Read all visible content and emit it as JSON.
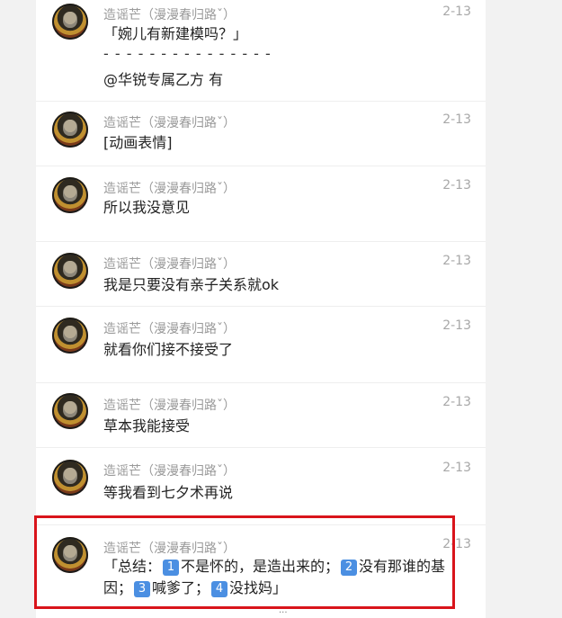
{
  "comments": [
    {
      "user": "造谣芒（漫漫春归路ˇ）",
      "date": "2-13",
      "text": "「婉儿有新建模吗？」",
      "dashes": "- - - - - - - - - - - - - - -",
      "mention": "@华锐专属乙方 有"
    },
    {
      "user": "造谣芒（漫漫春归路ˇ）",
      "date": "2-13",
      "text": "[动画表情]"
    },
    {
      "user": "造谣芒（漫漫春归路ˇ）",
      "date": "2-13",
      "text": "所以我没意见"
    },
    {
      "user": "造谣芒（漫漫春归路ˇ）",
      "date": "2-13",
      "text": "我是只要没有亲子关系就ok"
    },
    {
      "user": "造谣芒（漫漫春归路ˇ）",
      "date": "2-13",
      "text": "就看你们接不接受了"
    },
    {
      "user": "造谣芒（漫漫春归路ˇ）",
      "date": "2-13",
      "text": "草本我能接受"
    },
    {
      "user": "造谣芒（漫漫春归路ˇ）",
      "date": "2-13",
      "text": "等我看到七夕术再说"
    },
    {
      "user": "造谣芒（漫漫春归路ˇ）",
      "date": "2-13",
      "summary": {
        "prefix": "「总结：",
        "k1": "1",
        "p1": "不是怀的，是造出来的；",
        "k2": "2",
        "p2": "没有那谁的基因；",
        "k3": "3",
        "p3": "喊爹了；",
        "k4": "4",
        "p4": "没找妈」"
      }
    }
  ],
  "more_indicator": "···",
  "colors": {
    "highlight_border": "#d9141b",
    "keycap": "#4b8fe2"
  }
}
